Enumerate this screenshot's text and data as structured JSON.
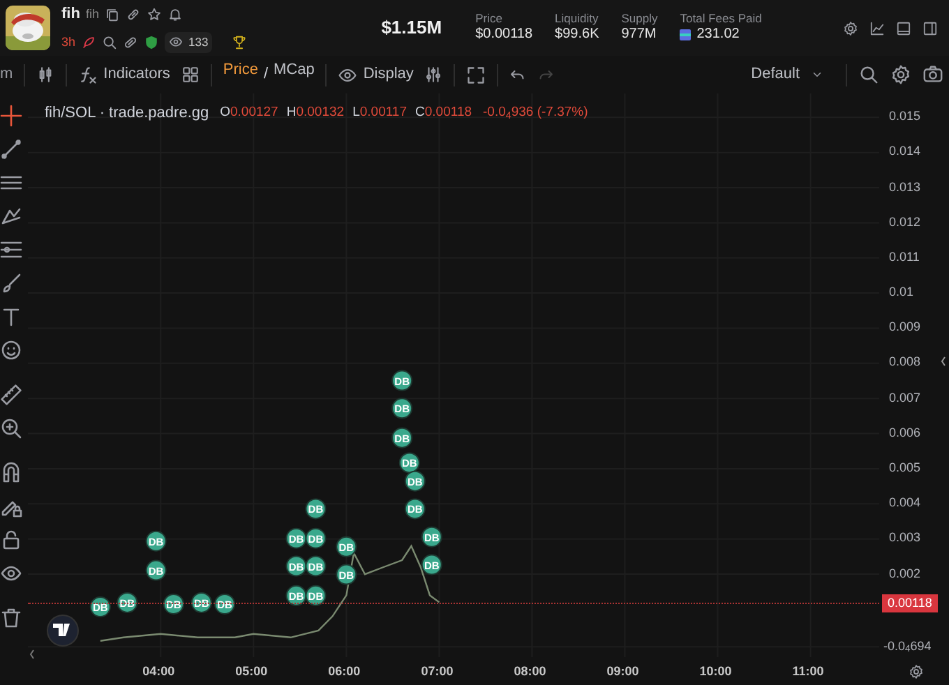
{
  "token": {
    "name": "fih",
    "ticker": "fih",
    "age": "3h",
    "watchers": "133"
  },
  "market_cap": "$1.15M",
  "stats": [
    {
      "label": "Price",
      "value": "$0.00118",
      "kind": "plain"
    },
    {
      "label": "Liquidity",
      "value": "$99.6K",
      "kind": "plain"
    },
    {
      "label": "Supply",
      "value": "977M",
      "kind": "plain"
    },
    {
      "label": "Total Fees Paid",
      "value": "231.02",
      "kind": "fees"
    }
  ],
  "toolbar": {
    "interval": "m",
    "indicators": "Indicators",
    "price_mode": [
      {
        "label": "Price",
        "selected": true
      },
      {
        "label": "MCap",
        "selected": false
      }
    ],
    "mode_separator": "/",
    "display": "Display",
    "undo_disabled": false,
    "redo_disabled": true,
    "layout": "Default"
  },
  "drawing_tools": [
    {
      "selected": true
    },
    {
      "selected": false
    },
    {
      "selected": false
    },
    {
      "selected": false
    },
    {
      "selected": false
    },
    {
      "selected": false
    },
    {
      "selected": false
    },
    {
      "selected": false
    },
    {
      "selected": false
    },
    {
      "selected": false
    },
    {
      "selected": false
    },
    {
      "selected": false
    },
    {
      "selected": false
    },
    {
      "selected": false
    },
    {
      "selected": false
    }
  ],
  "legend": {
    "symbol": "fih/SOL · trade.padre.gg",
    "ohlc": [
      {
        "key": "O",
        "value": "0.00127"
      },
      {
        "key": "H",
        "value": "0.00132"
      },
      {
        "key": "L",
        "value": "0.00117"
      },
      {
        "key": "C",
        "value": "0.00118"
      }
    ],
    "change": "-0.0$_{4}$936 (-7.37%)"
  },
  "chart": {
    "chart_data": {
      "type": "line",
      "x": [
        3.35,
        3.6,
        4.0,
        4.4,
        4.8,
        5.0,
        5.4,
        5.7,
        5.85,
        6.0,
        6.08,
        6.2,
        6.4,
        6.6,
        6.7,
        6.8,
        6.9,
        7.0
      ],
      "grid": true,
      "ref_lines": [
        {
          "axis": "y",
          "value": 0.00118,
          "label": "0.00118",
          "color": "#aa3333"
        }
      ],
      "series": [
        {
          "color": "#7a8a70",
          "values": [
            0.0001,
            0.0002,
            0.0003,
            0.0002,
            0.0002,
            0.0003,
            0.0002,
            0.0004,
            0.0008,
            0.0014,
            0.0026,
            0.002,
            0.0022,
            0.0024,
            0.0028,
            0.0022,
            0.0014,
            0.0012
          ]
        }
      ],
      "xlim": [
        2.57,
        11.74
      ],
      "ylim": [
        -0.00036,
        0.01568
      ],
      "xticks": [
        {
          "value": 4,
          "label": "04:00"
        },
        {
          "value": 5,
          "label": "05:00"
        },
        {
          "value": 6,
          "label": "06:00"
        },
        {
          "value": 7,
          "label": "07:00"
        },
        {
          "value": 8,
          "label": "08:00"
        },
        {
          "value": 9,
          "label": "09:00"
        },
        {
          "value": 10,
          "label": "10:00"
        },
        {
          "value": 11,
          "label": "11:00"
        }
      ],
      "yticks": [
        0.015,
        0.014,
        0.013,
        0.012,
        0.011,
        0.01,
        0.009,
        0.008,
        0.007,
        0.006,
        0.005,
        0.004,
        0.003,
        0.002,
        {
          "value": -6.94e-05,
          "label": "-0.0$_{4}$694"
        }
      ],
      "annotations": [
        {
          "x": 3.35,
          "y": 0.00107,
          "text": "DB"
        },
        {
          "x": 3.64,
          "y": 0.00119,
          "text": "DB"
        },
        {
          "x": 3.95,
          "y": 0.00294,
          "text": "DB"
        },
        {
          "x": 3.95,
          "y": 0.00211,
          "text": "DB"
        },
        {
          "x": 4.14,
          "y": 0.00115,
          "text": "DB"
        },
        {
          "x": 4.44,
          "y": 0.00119,
          "text": "DB"
        },
        {
          "x": 4.69,
          "y": 0.00115,
          "text": "DB"
        },
        {
          "x": 5.46,
          "y": 0.00302,
          "text": "DB"
        },
        {
          "x": 5.46,
          "y": 0.00223,
          "text": "DB"
        },
        {
          "x": 5.46,
          "y": 0.00139,
          "text": "DB"
        },
        {
          "x": 5.67,
          "y": 0.00386,
          "text": "DB"
        },
        {
          "x": 5.67,
          "y": 0.00302,
          "text": "DB"
        },
        {
          "x": 5.67,
          "y": 0.00223,
          "text": "DB"
        },
        {
          "x": 5.67,
          "y": 0.00139,
          "text": "DB"
        },
        {
          "x": 6.0,
          "y": 0.00278,
          "text": "DB"
        },
        {
          "x": 6.0,
          "y": 0.00199,
          "text": "DB"
        },
        {
          "x": 6.6,
          "y": 0.00751,
          "text": "DB"
        },
        {
          "x": 6.6,
          "y": 0.00672,
          "text": "DB"
        },
        {
          "x": 6.6,
          "y": 0.00588,
          "text": "DB"
        },
        {
          "x": 6.68,
          "y": 0.00517,
          "text": "DB"
        },
        {
          "x": 6.74,
          "y": 0.00465,
          "text": "DB"
        },
        {
          "x": 6.74,
          "y": 0.00386,
          "text": "DB"
        },
        {
          "x": 6.92,
          "y": 0.00306,
          "text": "DB"
        },
        {
          "x": 6.92,
          "y": 0.00227,
          "text": "DB"
        }
      ]
    }
  }
}
